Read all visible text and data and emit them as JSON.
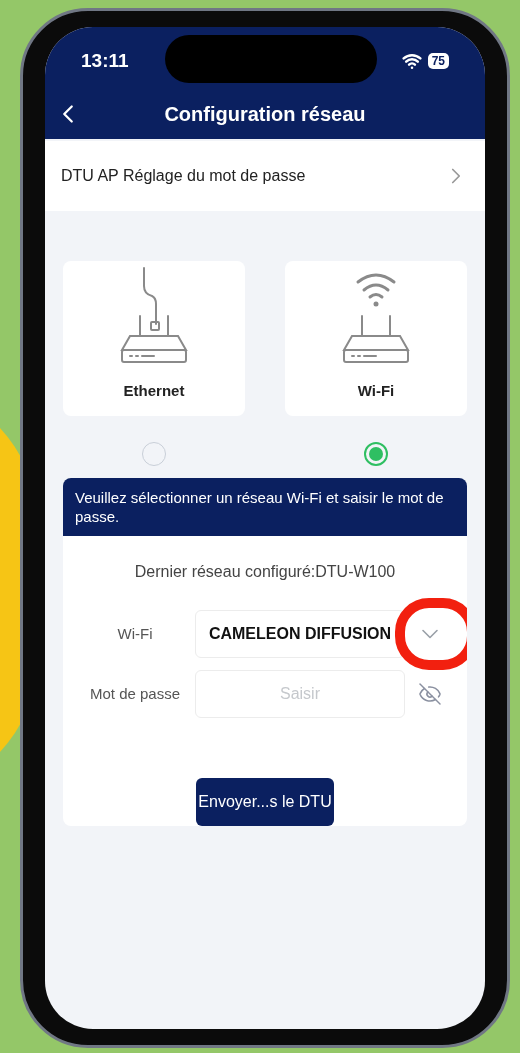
{
  "status_bar": {
    "time": "13:11",
    "battery": "75"
  },
  "header": {
    "title": "Configuration réseau"
  },
  "settings_row": {
    "label": "DTU AP Réglage du mot de passe"
  },
  "modes": [
    {
      "kind": "ethernet",
      "label": "Ethernet",
      "selected": false
    },
    {
      "kind": "wifi",
      "label": "Wi-Fi",
      "selected": true
    }
  ],
  "instruction": "Veuillez sélectionner un réseau Wi-Fi et saisir le mot de passe.",
  "form": {
    "last_network": "Dernier réseau configuré:DTU-W100",
    "wifi": {
      "label": "Wi-Fi",
      "value": "CAMELEON DIFFUSION"
    },
    "password": {
      "label": "Mot de passe",
      "placeholder": "Saisir",
      "visible": false
    }
  },
  "submit": "Envoyer...s le DTU"
}
